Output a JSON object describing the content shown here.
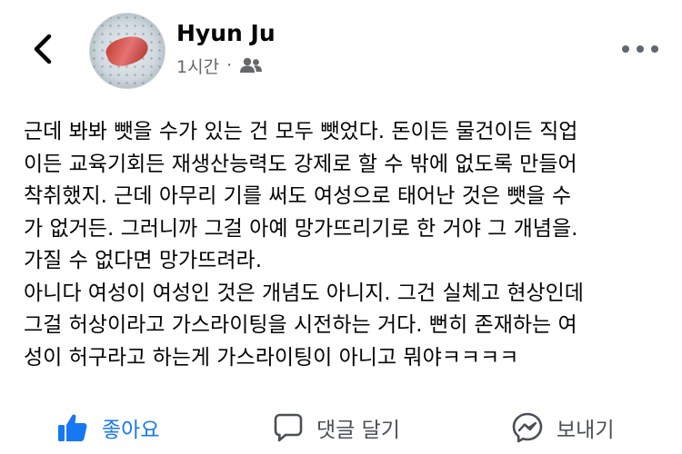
{
  "post": {
    "author": "Hyun Ju",
    "time": "1시간",
    "separator": "·",
    "audience_icon": "friends-icon",
    "lines": [
      "근데 봐봐 뺏을 수가 있는 건 모두 뺏었다. 돈이든 물건이든 직업",
      "이든 교육기회든 재생산능력도 강제로 할 수 밖에 없도록 만들어",
      "착취했지. 근데 아무리 기를 써도 여성으로 태어난 것은 뺏을 수",
      "가 없거든. 그러니까 그걸 아예 망가뜨리기로 한 거야 그 개념을.",
      "가질 수 없다면 망가뜨려라.",
      "아니다 여성이 여성인 것은 개념도 아니지. 그건 실체고 현상인데",
      "그걸 허상이라고 가스라이팅을 시전하는 거다. 뻔히 존재하는 여",
      "성이 허구라고 하는게 가스라이팅이 아니고 뭐야ㅋㅋㅋㅋ"
    ]
  },
  "actions": {
    "like": "좋아요",
    "comment": "댓글 달기",
    "share": "보내기"
  },
  "colors": {
    "accent": "#1877f2",
    "secondary_text": "#65676b",
    "icon_gray": "#4b4f56"
  }
}
